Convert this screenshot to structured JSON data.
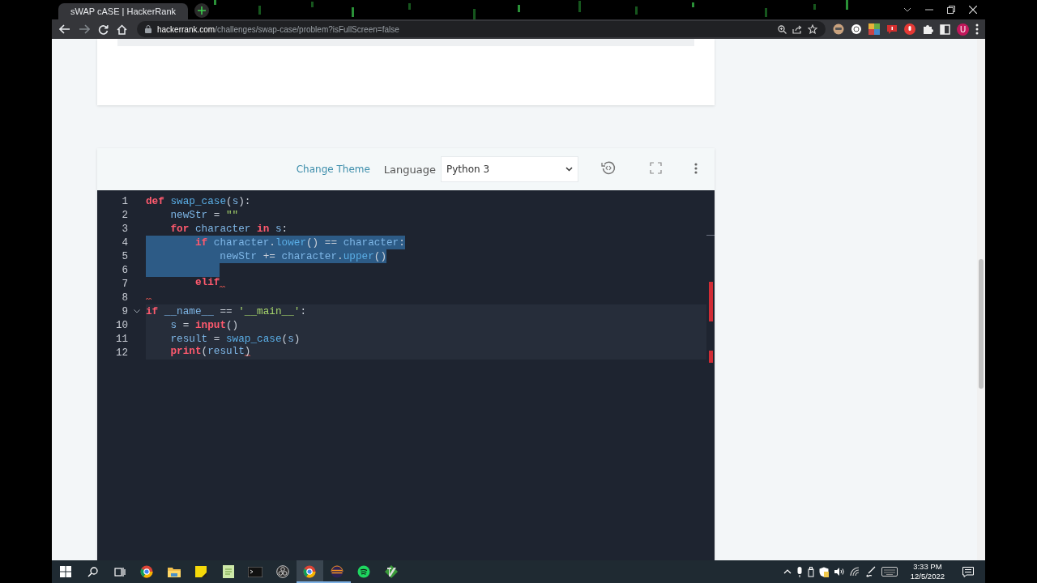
{
  "browser": {
    "tab": {
      "title": "sWAP cASE | HackerRank",
      "selected": true
    },
    "url": {
      "host": "hackerrank.com",
      "path": "/challenges/swap-case/problem?isFullScreen=false"
    },
    "profile": "U"
  },
  "editor": {
    "change_theme": "Change Theme",
    "language_label": "Language",
    "language": "Python 3",
    "lines": [
      {
        "number": "1",
        "selected": false,
        "highlighted": false,
        "fold_marker": false,
        "tokens": [
          {
            "kind": "keyword",
            "text": "def "
          },
          {
            "kind": "function",
            "text": "swap_case"
          },
          {
            "kind": "punct",
            "text": "("
          },
          {
            "kind": "variable",
            "text": "s"
          },
          {
            "kind": "punct",
            "text": "):"
          }
        ]
      },
      {
        "number": "2",
        "selected": false,
        "highlighted": false,
        "fold_marker": false,
        "tokens": [
          {
            "kind": "variable",
            "text": "    newStr"
          },
          {
            "kind": "punct",
            "text": " = "
          },
          {
            "kind": "string",
            "text": "\"\""
          }
        ]
      },
      {
        "number": "3",
        "selected": false,
        "highlighted": false,
        "fold_marker": false,
        "tokens": [
          {
            "kind": "keyword",
            "text": "    for "
          },
          {
            "kind": "variable",
            "text": "character "
          },
          {
            "kind": "keyword",
            "text": "in "
          },
          {
            "kind": "variable",
            "text": "s"
          },
          {
            "kind": "punct",
            "text": ":"
          }
        ]
      },
      {
        "number": "4",
        "selected": true,
        "highlighted": false,
        "fold_marker": false,
        "tokens": [
          {
            "kind": "keyword",
            "text": "        if "
          },
          {
            "kind": "variable",
            "text": "character"
          },
          {
            "kind": "punct",
            "text": "."
          },
          {
            "kind": "function",
            "text": "lower"
          },
          {
            "kind": "punct",
            "text": "() == "
          },
          {
            "kind": "variable",
            "text": "character"
          },
          {
            "kind": "punct",
            "text": ":"
          }
        ]
      },
      {
        "number": "5",
        "selected": true,
        "highlighted": false,
        "fold_marker": false,
        "tokens": [
          {
            "kind": "variable",
            "text": "            newStr"
          },
          {
            "kind": "punct",
            "text": " += "
          },
          {
            "kind": "variable",
            "text": "character"
          },
          {
            "kind": "punct",
            "text": "."
          },
          {
            "kind": "function",
            "text": "upper"
          },
          {
            "kind": "punct",
            "text": "()"
          }
        ]
      },
      {
        "number": "6",
        "selected": true,
        "highlighted": false,
        "fold_marker": false
      },
      {
        "number": "7",
        "selected": false,
        "highlighted": false,
        "fold_marker": false,
        "tokens": [
          {
            "kind": "keyword",
            "text": "        elif"
          },
          {
            "kind": "squiggle"
          }
        ]
      },
      {
        "number": "8",
        "selected": false,
        "highlighted": false,
        "fold_marker": false,
        "tokens": [
          {
            "kind": "squiggle"
          }
        ]
      },
      {
        "number": "9",
        "selected": false,
        "highlighted": true,
        "fold_marker": true,
        "tokens": [
          {
            "kind": "keyword",
            "text": "if "
          },
          {
            "kind": "variable",
            "text": "__name__"
          },
          {
            "kind": "punct",
            "text": " == "
          },
          {
            "kind": "string",
            "text": "'__main__'"
          },
          {
            "kind": "punct",
            "text": ":"
          }
        ]
      },
      {
        "number": "10",
        "selected": false,
        "highlighted": true,
        "fold_marker": false,
        "tokens": [
          {
            "kind": "variable",
            "text": "    s"
          },
          {
            "kind": "punct",
            "text": " = "
          },
          {
            "kind": "keyword",
            "text": "input"
          },
          {
            "kind": "punct",
            "text": "()"
          }
        ]
      },
      {
        "number": "11",
        "selected": false,
        "highlighted": true,
        "fold_marker": false,
        "tokens": [
          {
            "kind": "variable",
            "text": "    result"
          },
          {
            "kind": "punct",
            "text": " = "
          },
          {
            "kind": "function",
            "text": "swap_case"
          },
          {
            "kind": "punct",
            "text": "("
          },
          {
            "kind": "variable",
            "text": "s"
          },
          {
            "kind": "punct",
            "text": ")"
          }
        ]
      },
      {
        "number": "12",
        "selected": false,
        "highlighted": true,
        "fold_marker": false,
        "tokens": [
          {
            "kind": "keyword",
            "text": "    print"
          },
          {
            "kind": "punct",
            "text": "("
          },
          {
            "kind": "variable",
            "text": "result"
          },
          {
            "kind": "squiggle"
          },
          {
            "kind": "punct",
            "text": ")"
          }
        ]
      }
    ]
  },
  "taskbar": {
    "apps": [
      {
        "kind": "start",
        "running": false,
        "selected": false
      },
      {
        "kind": "search",
        "running": false,
        "selected": false
      },
      {
        "kind": "taskview",
        "running": false,
        "selected": false
      },
      {
        "kind": "chrome",
        "running": false,
        "selected": false
      },
      {
        "kind": "files",
        "running": false,
        "selected": false
      },
      {
        "kind": "sticky",
        "running": false,
        "selected": false
      },
      {
        "kind": "notepad",
        "running": false,
        "selected": false
      },
      {
        "kind": "terminal",
        "running": false,
        "selected": false
      },
      {
        "kind": "obs",
        "running": false,
        "selected": false
      },
      {
        "kind": "chrome",
        "running": true,
        "selected": true
      },
      {
        "kind": "eclipse",
        "running": true,
        "selected": false
      },
      {
        "kind": "spotify",
        "running": false,
        "selected": false
      },
      {
        "kind": "vim",
        "running": false,
        "selected": false
      }
    ],
    "time": "3:33 PM",
    "date": "12/5/2022"
  }
}
